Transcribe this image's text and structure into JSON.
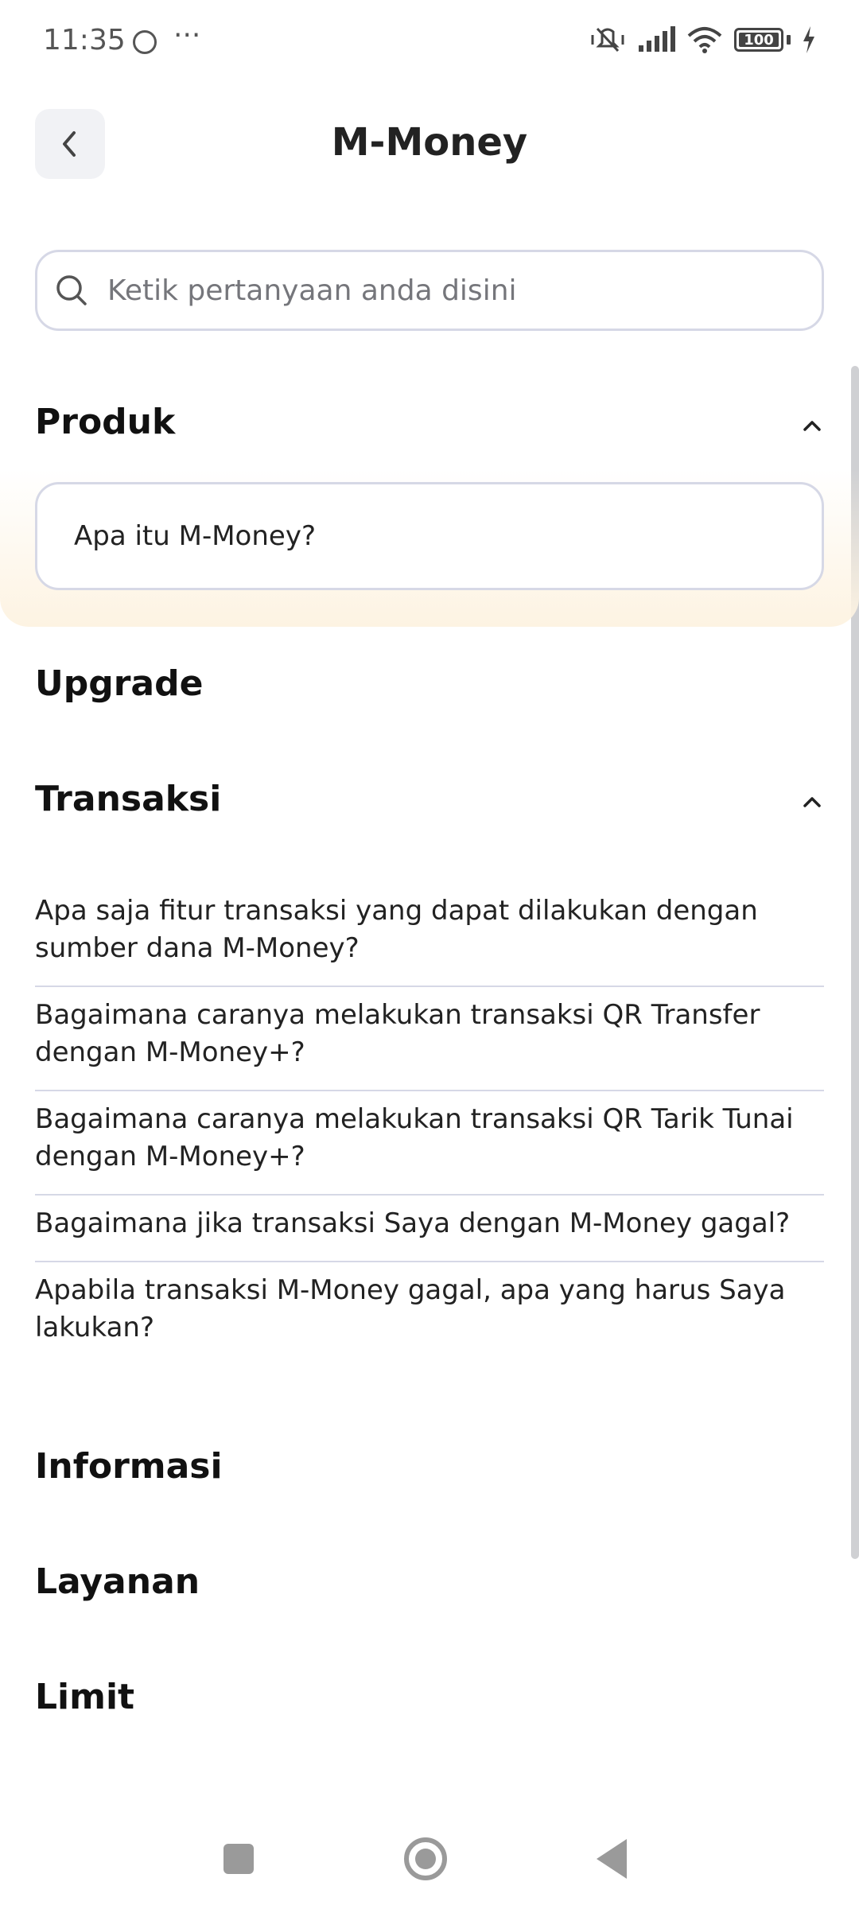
{
  "status_bar": {
    "time": "11:35",
    "battery": "100"
  },
  "header": {
    "title": "M-Money"
  },
  "search": {
    "placeholder": "Ketik pertanyaan anda disini",
    "value": ""
  },
  "sections": {
    "produk": {
      "title": "Produk",
      "items": [
        "Apa itu M-Money?"
      ]
    },
    "upgrade": {
      "title": "Upgrade"
    },
    "transaksi": {
      "title": "Transaksi",
      "items": [
        "Apa saja fitur transaksi yang dapat dilakukan dengan sumber dana M-Money?",
        "Bagaimana caranya melakukan transaksi QR Transfer dengan M-Money+?",
        "Bagaimana caranya melakukan transaksi QR Tarik Tunai dengan M-Money+?",
        "Bagaimana jika transaksi Saya dengan M-Money gagal?",
        "Apabila transaksi M-Money gagal, apa yang harus Saya lakukan?"
      ]
    },
    "informasi": {
      "title": "Informasi"
    },
    "layanan": {
      "title": "Layanan"
    },
    "limit": {
      "title": "Limit"
    }
  },
  "colors": {
    "accent_glow": "#fdf3e2",
    "border": "#d6d8e6",
    "back_bg": "#f1f2f5"
  },
  "icons": [
    "chevron-left-icon",
    "search-icon",
    "chevron-up-icon"
  ]
}
